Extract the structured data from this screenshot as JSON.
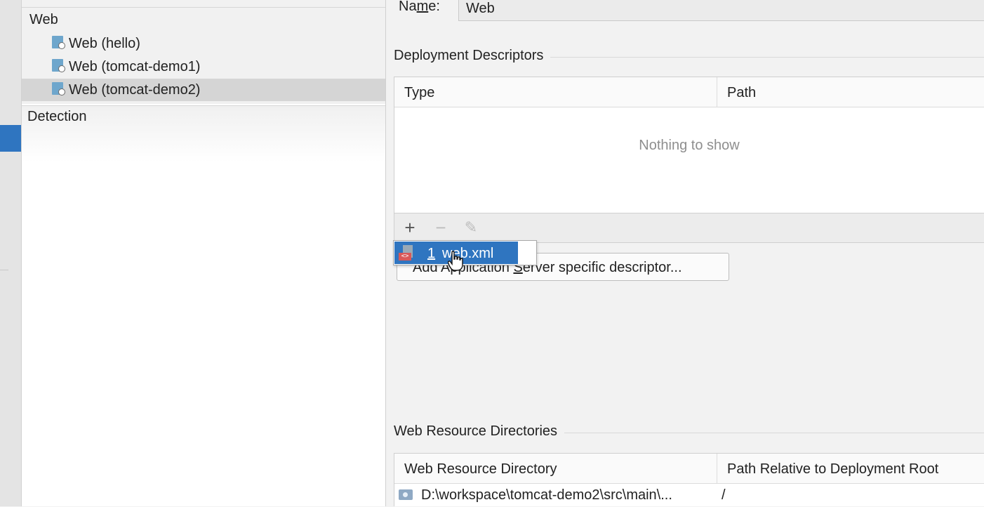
{
  "tree": {
    "header": "Web",
    "items": [
      {
        "label": "Web (hello)",
        "selected": false
      },
      {
        "label": "Web (tomcat-demo1)",
        "selected": false
      },
      {
        "label": "Web (tomcat-demo2)",
        "selected": true
      }
    ],
    "detection_label": "Detection"
  },
  "name_field": {
    "label_pre": "Na",
    "label_mnemonic": "m",
    "label_post": "e:",
    "value": "Web"
  },
  "deployment_descriptors": {
    "title": "Deployment Descriptors",
    "columns": [
      "Type",
      "Path"
    ],
    "empty_text": "Nothing to show",
    "toolbar": {
      "add": "+",
      "remove": "−",
      "edit": "✎"
    }
  },
  "add_server_button": {
    "pre": "Add Application ",
    "mnemonic": "S",
    "post": "erver specific descriptor..."
  },
  "popup": {
    "mnemonic": "1",
    "label": "web.xml"
  },
  "web_resources": {
    "title": "Web Resource Directories",
    "columns": [
      "Web Resource Directory",
      "Path Relative to Deployment Root"
    ],
    "rows": [
      {
        "directory": "D:\\workspace\\tomcat-demo2\\src\\main\\...",
        "relative_path": "/"
      }
    ]
  },
  "colors": {
    "selection_blue": "#2f75c0",
    "tree_selected": "#d5d5d5"
  }
}
